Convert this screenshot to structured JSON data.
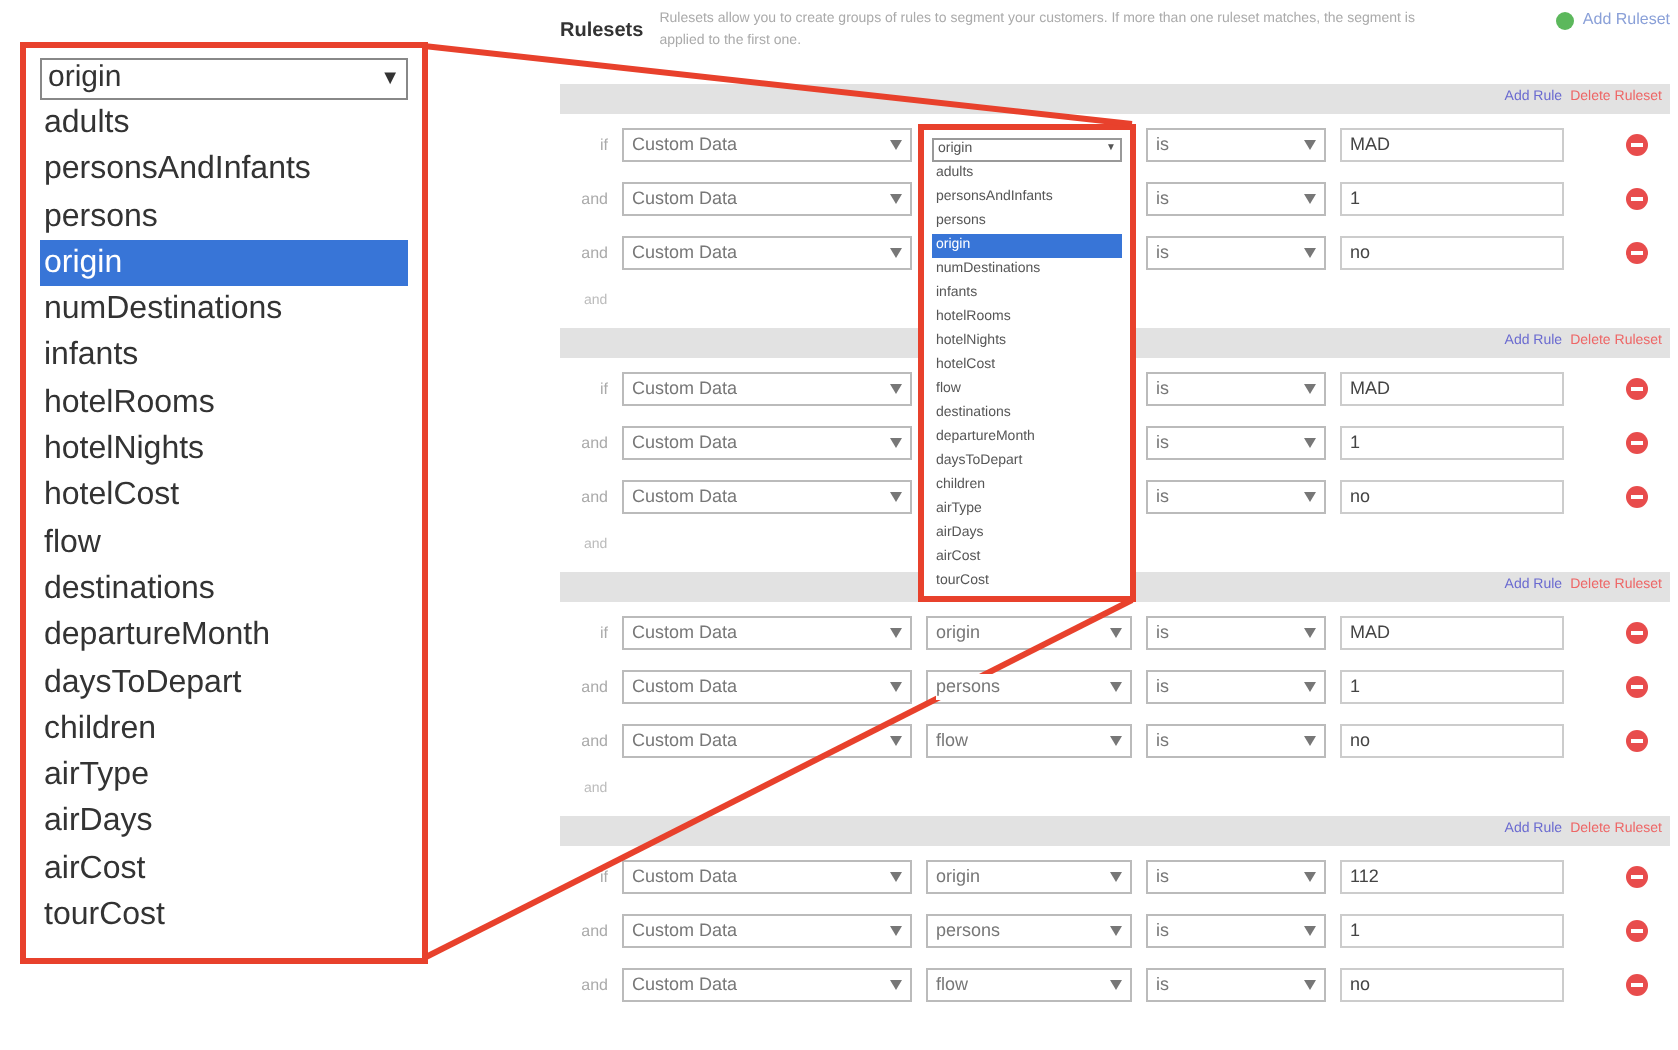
{
  "page": {
    "title": "Rulesets",
    "description": "Rulesets allow you to create groups of rules to segment your customers. If more than one ruleset matches, the segment is applied to the first one.",
    "add_ruleset": "Add Ruleset"
  },
  "rulesets": [
    {
      "add_rule": "Add Rule",
      "delete": "Delete Ruleset",
      "footer": "and",
      "rules": [
        {
          "connector": "if",
          "source": "Custom Data",
          "operator": "is",
          "value": "MAD"
        },
        {
          "connector": "and",
          "source": "Custom Data",
          "operator": "is",
          "value": "1"
        },
        {
          "connector": "and",
          "source": "Custom Data",
          "operator": "is",
          "value": "no"
        }
      ]
    },
    {
      "add_rule": "Add Rule",
      "delete": "Delete Ruleset",
      "footer": "and",
      "rules": [
        {
          "connector": "if",
          "source": "Custom Data",
          "operator": "is",
          "value": "MAD"
        },
        {
          "connector": "and",
          "source": "Custom Data",
          "operator": "is",
          "value": "1"
        },
        {
          "connector": "and",
          "source": "Custom Data",
          "operator": "is",
          "value": "no"
        }
      ]
    },
    {
      "add_rule": "Add Rule",
      "delete": "Delete Ruleset",
      "footer": "and",
      "rules": [
        {
          "connector": "if",
          "source": "Custom Data",
          "field": "origin",
          "operator": "is",
          "value": "MAD"
        },
        {
          "connector": "and",
          "source": "Custom Data",
          "field": "persons",
          "operator": "is",
          "value": "1"
        },
        {
          "connector": "and",
          "source": "Custom Data",
          "field": "flow",
          "operator": "is",
          "value": "no"
        }
      ]
    },
    {
      "add_rule": "Add Rule",
      "delete": "Delete Ruleset",
      "rules": [
        {
          "connector": "if",
          "source": "Custom Data",
          "field": "origin",
          "operator": "is",
          "value": "112"
        },
        {
          "connector": "and",
          "source": "Custom Data",
          "field": "persons",
          "operator": "is",
          "value": "1"
        },
        {
          "connector": "and",
          "source": "Custom Data",
          "field": "flow",
          "operator": "is",
          "value": "no"
        }
      ]
    }
  ],
  "dropdown": {
    "value": "origin",
    "arrow": "▼",
    "options": [
      {
        "label": "adults",
        "selected": false
      },
      {
        "label": "personsAndInfants",
        "selected": false
      },
      {
        "label": "persons",
        "selected": false
      },
      {
        "label": "origin",
        "selected": true
      },
      {
        "label": "numDestinations",
        "selected": false
      },
      {
        "label": "infants",
        "selected": false
      },
      {
        "label": "hotelRooms",
        "selected": false
      },
      {
        "label": "hotelNights",
        "selected": false
      },
      {
        "label": "hotelCost",
        "selected": false
      },
      {
        "label": "flow",
        "selected": false
      },
      {
        "label": "destinations",
        "selected": false
      },
      {
        "label": "departureMonth",
        "selected": false
      },
      {
        "label": "daysToDepart",
        "selected": false
      },
      {
        "label": "children",
        "selected": false
      },
      {
        "label": "airType",
        "selected": false
      },
      {
        "label": "airDays",
        "selected": false
      },
      {
        "label": "airCost",
        "selected": false
      },
      {
        "label": "tourCost",
        "selected": false
      }
    ]
  },
  "zoomed_dropdown": {
    "value": "origin",
    "arrow": "▼",
    "options": [
      {
        "label": "adults",
        "selected": false
      },
      {
        "label": "personsAndInfants",
        "selected": false
      },
      {
        "label": "persons",
        "selected": false
      },
      {
        "label": "origin",
        "selected": true
      },
      {
        "label": "numDestinations",
        "selected": false
      },
      {
        "label": "infants",
        "selected": false
      },
      {
        "label": "hotelRooms",
        "selected": false
      },
      {
        "label": "hotelNights",
        "selected": false
      },
      {
        "label": "hotelCost",
        "selected": false
      },
      {
        "label": "flow",
        "selected": false
      },
      {
        "label": "destinations",
        "selected": false
      },
      {
        "label": "departureMonth",
        "selected": false
      },
      {
        "label": "daysToDepart",
        "selected": false
      },
      {
        "label": "children",
        "selected": false
      },
      {
        "label": "airType",
        "selected": false
      },
      {
        "label": "airDays",
        "selected": false
      },
      {
        "label": "airCost",
        "selected": false
      },
      {
        "label": "tourCost",
        "selected": false
      }
    ]
  }
}
